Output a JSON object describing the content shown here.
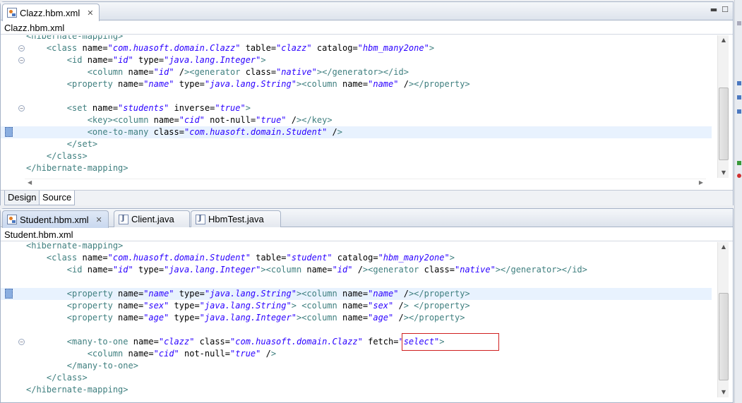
{
  "top_editor": {
    "tab_label": "Clazz.hbm.xml",
    "breadcrumb": "Clazz.hbm.xml",
    "bottom_tabs": [
      "Design",
      "Source"
    ],
    "active_bottom_tab": "Source",
    "lines": [
      {
        "text": "<hibernate-mapping>",
        "fold": false,
        "mark": false,
        "hl": false
      },
      {
        "text": "    <class name=\"com.huasoft.domain.Clazz\" table=\"clazz\" catalog=\"hbm_many2one\">",
        "fold": true,
        "mark": false,
        "hl": false
      },
      {
        "text": "        <id name=\"id\" type=\"java.lang.Integer\">",
        "fold": true,
        "mark": false,
        "hl": false
      },
      {
        "text": "            <column name=\"id\" /><generator class=\"native\"></generator></id>",
        "fold": false,
        "mark": false,
        "hl": false
      },
      {
        "text": "        <property name=\"name\" type=\"java.lang.String\"><column name=\"name\" /></property>",
        "fold": false,
        "mark": false,
        "hl": false
      },
      {
        "text": "",
        "fold": false,
        "mark": false,
        "hl": false
      },
      {
        "text": "        <set name=\"students\" inverse=\"true\">",
        "fold": true,
        "mark": false,
        "hl": false
      },
      {
        "text": "            <key><column name=\"cid\" not-null=\"true\" /></key>",
        "fold": false,
        "mark": false,
        "hl": false
      },
      {
        "text": "            <one-to-many class=\"com.huasoft.domain.Student\" />",
        "fold": false,
        "mark": true,
        "hl": true
      },
      {
        "text": "        </set>",
        "fold": false,
        "mark": false,
        "hl": false
      },
      {
        "text": "    </class>",
        "fold": false,
        "mark": false,
        "hl": false
      },
      {
        "text": "</hibernate-mapping>",
        "fold": false,
        "mark": false,
        "hl": false
      }
    ]
  },
  "bottom_editor": {
    "tabs": [
      {
        "label": "Student.hbm.xml",
        "icon": "xml-file-icon",
        "active": true,
        "closable": true
      },
      {
        "label": "Client.java",
        "icon": "java-file-icon",
        "active": false,
        "closable": false
      },
      {
        "label": "HbmTest.java",
        "icon": "java-file-icon",
        "active": false,
        "closable": false
      }
    ],
    "breadcrumb": "Student.hbm.xml",
    "lines": [
      {
        "text": "<hibernate-mapping>",
        "fold": false,
        "mark": false,
        "hl": false
      },
      {
        "text": "    <class name=\"com.huasoft.domain.Student\" table=\"student\" catalog=\"hbm_many2one\">",
        "fold": false,
        "mark": false,
        "hl": false
      },
      {
        "text": "        <id name=\"id\" type=\"java.lang.Integer\"><column name=\"id\" /><generator class=\"native\"></generator></id>",
        "fold": false,
        "mark": false,
        "hl": false
      },
      {
        "text": "",
        "fold": false,
        "mark": false,
        "hl": false
      },
      {
        "text": "        <property name=\"name\" type=\"java.lang.String\"><column name=\"name\" /></property>",
        "fold": false,
        "mark": true,
        "hl": true
      },
      {
        "text": "        <property name=\"sex\" type=\"java.lang.String\"> <column name=\"sex\" /> </property>",
        "fold": false,
        "mark": false,
        "hl": false
      },
      {
        "text": "        <property name=\"age\" type=\"java.lang.Integer\"><column name=\"age\" /></property>",
        "fold": false,
        "mark": false,
        "hl": false
      },
      {
        "text": "",
        "fold": false,
        "mark": false,
        "hl": false
      },
      {
        "text": "        <many-to-one name=\"clazz\" class=\"com.huasoft.domain.Clazz\" fetch=\"select\">",
        "fold": true,
        "mark": false,
        "hl": false
      },
      {
        "text": "            <column name=\"cid\" not-null=\"true\" />",
        "fold": false,
        "mark": false,
        "hl": false
      },
      {
        "text": "        </many-to-one>",
        "fold": false,
        "mark": false,
        "hl": false
      },
      {
        "text": "    </class>",
        "fold": false,
        "mark": false,
        "hl": false
      },
      {
        "text": "</hibernate-mapping>",
        "fold": false,
        "mark": false,
        "hl": false
      }
    ],
    "highlighted_text": "fetch=\"select\">"
  },
  "colors": {
    "tag": "#3f7f7f",
    "attribute": "#7f007f",
    "value": "#2a00ff",
    "current_line": "#e8f2fe",
    "callout_border": "#d02020"
  }
}
